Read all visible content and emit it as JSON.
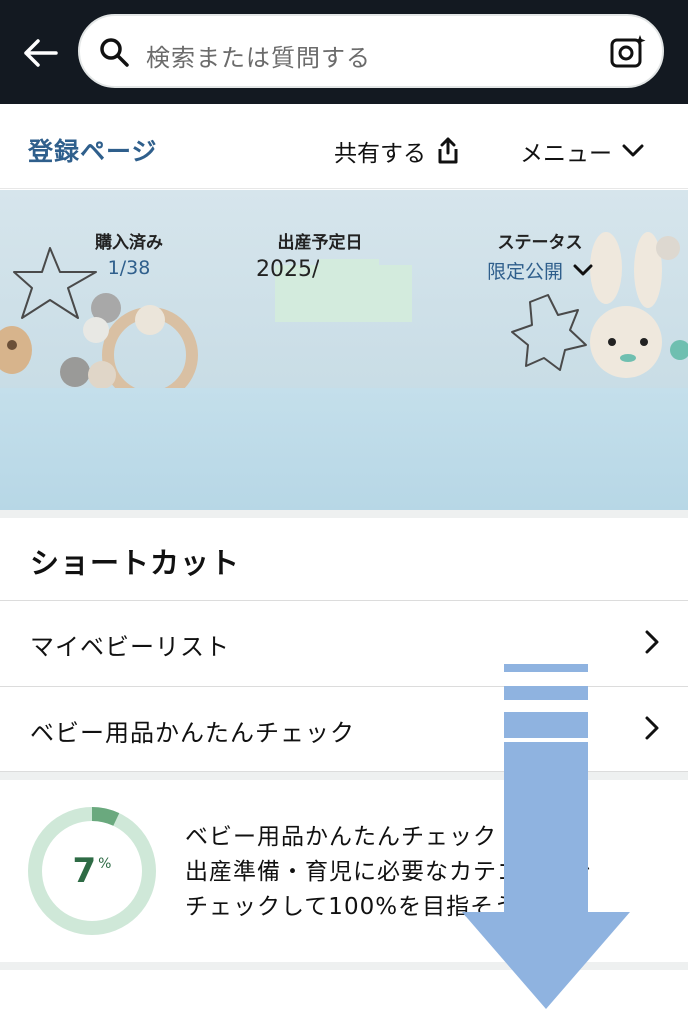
{
  "search": {
    "placeholder": "検索または質問する"
  },
  "subheader": {
    "registry_link": "登録ページ",
    "share_label": "共有する",
    "menu_label": "メニュー"
  },
  "stats": {
    "purchased": {
      "label": "購入済み",
      "value": "1/38"
    },
    "due_date": {
      "label": "出産予定日",
      "value": "2025/"
    },
    "status": {
      "label": "ステータス",
      "value": "限定公開"
    }
  },
  "shortcuts": {
    "title": "ショートカット",
    "items": [
      {
        "label": "マイベビーリスト"
      },
      {
        "label": "ベビー用品かんたんチェック"
      }
    ]
  },
  "progress": {
    "percent_number": "7",
    "percent_sign": "%",
    "fraction": 0.07,
    "line1": "ベビー用品かんたんチェック",
    "line2": "出産準備・育児に必要なカテゴリーを",
    "line3": "チェックして100%を目指そう"
  },
  "colors": {
    "topbar": "#131921",
    "link": "#2f5f8c",
    "ring_track": "#cfe8d8",
    "ring_fill": "#6aa97e",
    "overlay_arrow": "#8fb3e0"
  }
}
